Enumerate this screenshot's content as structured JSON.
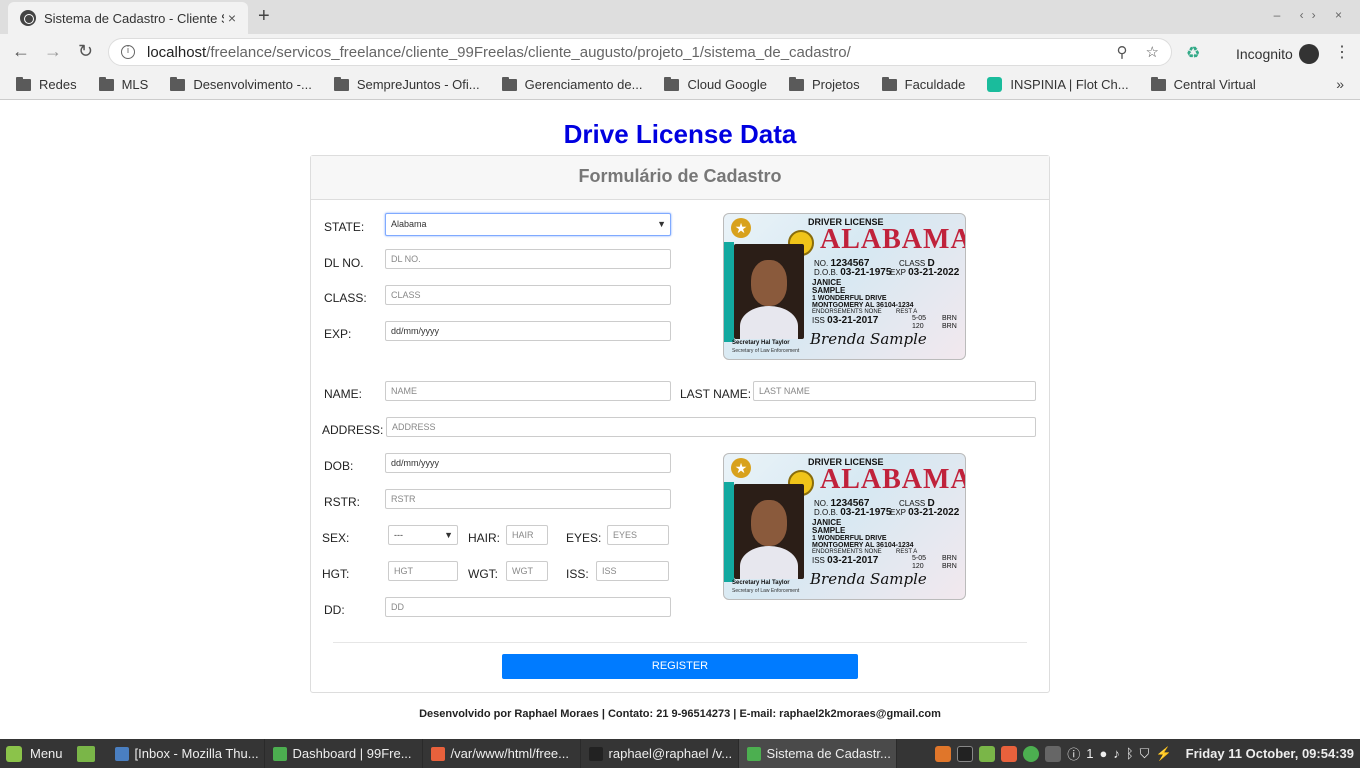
{
  "browser": {
    "tab_title": "Sistema de Cadastro - Cliente S",
    "tab_close": "×",
    "new_tab": "+",
    "url_host": "localhost",
    "url_path": "/freelance/servicos_freelance/cliente_99Freelas/cliente_augusto/projeto_1/sistema_de_cadastro/",
    "incognito_label": "Incognito",
    "bookmarks": [
      {
        "label": "Redes",
        "icon": "folder-icon"
      },
      {
        "label": "MLS",
        "icon": "folder-icon"
      },
      {
        "label": "Desenvolvimento -...",
        "icon": "folder-icon"
      },
      {
        "label": "SempreJuntos - Ofi...",
        "icon": "folder-icon"
      },
      {
        "label": "Gerenciamento de...",
        "icon": "folder-icon"
      },
      {
        "label": "Cloud Google",
        "icon": "folder-icon"
      },
      {
        "label": "Projetos",
        "icon": "folder-icon"
      },
      {
        "label": "Faculdade",
        "icon": "folder-icon"
      },
      {
        "label": "INSPINIA | Flot Ch...",
        "icon": "inspinia-icon"
      },
      {
        "label": "Central Virtual",
        "icon": "folder-icon"
      }
    ]
  },
  "page": {
    "title": "Drive License Data",
    "form_title": "Formulário de Cadastro",
    "labels": {
      "state": "STATE:",
      "dl_no": "DL NO.",
      "class": "CLASS:",
      "exp": "EXP:",
      "name": "NAME:",
      "last_name": "LAST NAME:",
      "address": "ADDRESS:",
      "dob": "DOB:",
      "rstr": "RSTR:",
      "sex": "SEX:",
      "hair": "HAIR:",
      "eyes": "EYES:",
      "hgt": "HGT:",
      "wgt": "WGT:",
      "iss": "ISS:",
      "dd": "DD:"
    },
    "fields": {
      "state_value": "Alabama",
      "dl_no_placeholder": "DL NO.",
      "class_placeholder": "CLASS",
      "exp_placeholder": "dd/mm/yyyy",
      "name_placeholder": "NAME",
      "last_name_placeholder": "LAST NAME",
      "address_placeholder": "ADDRESS",
      "dob_placeholder": "dd/mm/yyyy",
      "rstr_placeholder": "RSTR",
      "sex_value": "---",
      "hair_placeholder": "HAIR",
      "eyes_placeholder": "EYES",
      "hgt_placeholder": "HGT",
      "wgt_placeholder": "WGT",
      "iss_placeholder": "ISS",
      "dd_placeholder": "DD"
    },
    "register_label": "REGISTER",
    "license_card": {
      "header": "DRIVER LICENSE",
      "state": "ALABAMA",
      "no_label": "NO.",
      "no": "1234567",
      "class_label": "CLASS",
      "class": "D",
      "dob_label": "D.O.B.",
      "dob": "03-21-1975",
      "exp_label": "EXP",
      "exp": "03-21-2022",
      "first_name": "JANICE",
      "last_name": "SAMPLE",
      "address1": "1 WONDERFUL DRIVE",
      "address2": "MONTGOMERY AL 36104-1234",
      "endorsements": "ENDORSEMENTS NONE",
      "rest": "REST A",
      "iss_label": "ISS",
      "iss": "03-21-2017",
      "hgt": "5-05",
      "wgt": "120",
      "eyes": "BRN",
      "hair": "BRN",
      "signature": "Brenda Sample",
      "secretary": "Secretary Hal Taylor",
      "secretary_title": "Secretary of Law Enforcement",
      "sample": "SAMPLE"
    },
    "footer": "Desenvolvido por Raphael Moraes | Contato: 21 9-96514273 | E-mail: raphael2k2moraes@gmail.com"
  },
  "taskbar": {
    "menu_label": "Menu",
    "tasks": [
      {
        "label": "[Inbox - Mozilla Thu...",
        "active": false
      },
      {
        "label": "Dashboard | 99Fre...",
        "active": false
      },
      {
        "label": "/var/www/html/free...",
        "active": false
      },
      {
        "label": "raphael@raphael /v...",
        "active": false
      },
      {
        "label": "Sistema de Cadastr...",
        "active": true
      }
    ],
    "workspace": "1",
    "clock": "Friday 11 October, 09:54:39"
  }
}
